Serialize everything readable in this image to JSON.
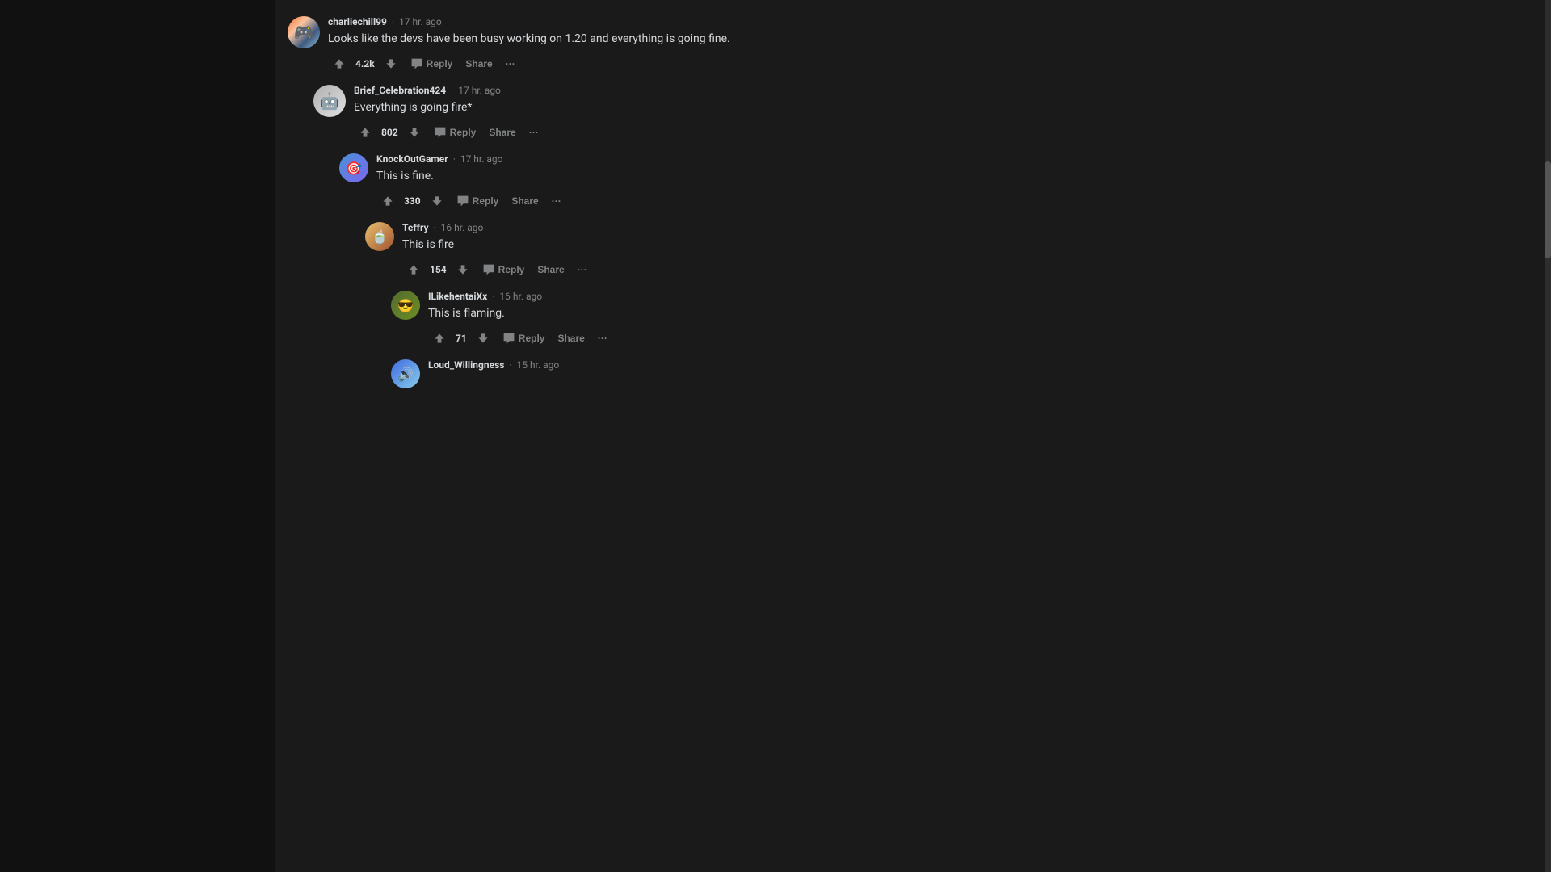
{
  "comments": [
    {
      "id": "comment-1",
      "level": 0,
      "username": "charliechill99",
      "timestamp": "17 hr. ago",
      "text": "Looks like the devs have been busy working on 1.20 and everything is going fine.",
      "upvotes": "4.2k",
      "avatar_class": "av-charliechill",
      "avatar_emoji": "🎮"
    },
    {
      "id": "comment-2",
      "level": 1,
      "username": "Brief_Celebration424",
      "timestamp": "17 hr. ago",
      "text": "Everything is going fire*",
      "upvotes": "802",
      "avatar_class": "av-brief",
      "avatar_emoji": "🤖"
    },
    {
      "id": "comment-3",
      "level": 2,
      "username": "KnockOutGamer",
      "timestamp": "17 hr. ago",
      "text": "This is fine.",
      "upvotes": "330",
      "avatar_class": "av-knockout",
      "avatar_emoji": "🎯"
    },
    {
      "id": "comment-4",
      "level": 3,
      "username": "Teffry",
      "timestamp": "16 hr. ago",
      "text": "This is fire",
      "upvotes": "154",
      "avatar_class": "av-teffry",
      "avatar_emoji": "🍵"
    },
    {
      "id": "comment-5",
      "level": 4,
      "username": "ILikehentaiXx",
      "timestamp": "16 hr. ago",
      "text": "This is flaming.",
      "upvotes": "71",
      "avatar_class": "av-ilike",
      "avatar_emoji": "😎"
    },
    {
      "id": "comment-6",
      "level": 4,
      "username": "Loud_Willingness",
      "timestamp": "15 hr. ago",
      "text": "",
      "upvotes": "",
      "avatar_class": "av-loud",
      "avatar_emoji": "🔊"
    }
  ],
  "actions": {
    "reply": "Reply",
    "share": "Share",
    "more": "···"
  }
}
